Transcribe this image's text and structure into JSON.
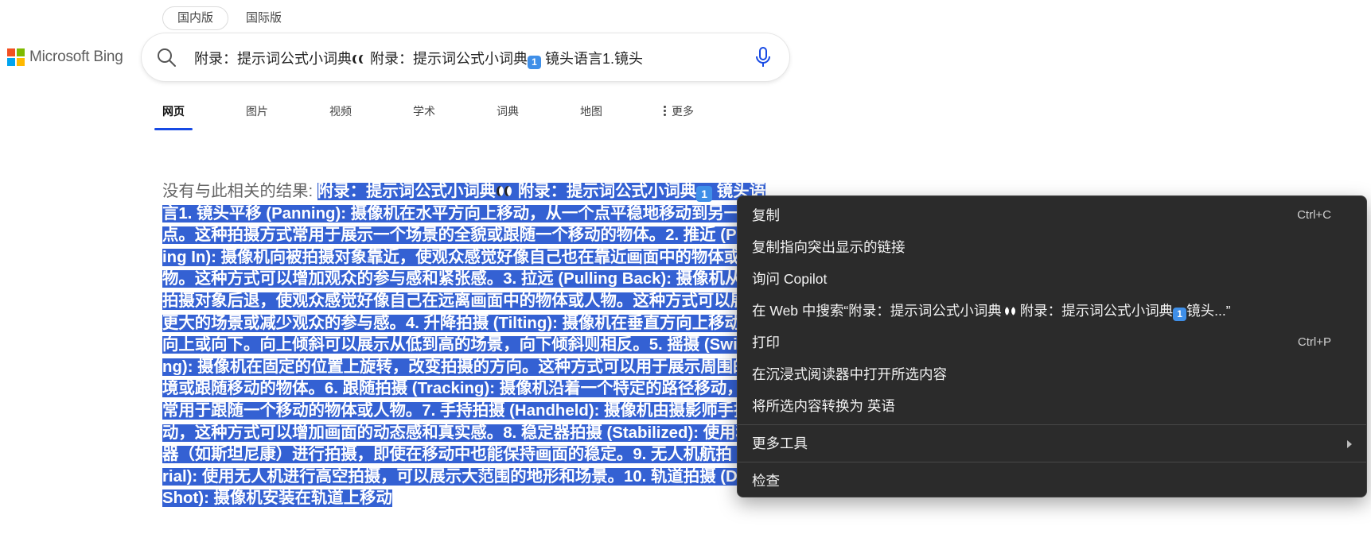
{
  "region": {
    "domestic": "国内版",
    "international": "国际版"
  },
  "logo": {
    "text": "Microsoft Bing"
  },
  "search": {
    "query_part1": "附录：提示词公式小词典",
    "query_part2": " 附录：提示词公式小词典",
    "query_keycap": "1",
    "query_part3": "镜头语言1.镜头"
  },
  "tabs": [
    "网页",
    "图片",
    "视频",
    "学术",
    "词典",
    "地图",
    "更多"
  ],
  "result": {
    "no_result_label": "没有与此相关的结果: ",
    "selected_part1": "附录：提示词公式小词典",
    "selected_part2": " 附录：提示词公式小词典",
    "selected_keycap": "1",
    "selected_part3": " 镜头语言1. 镜头平移 (Panning): 摄像机在水平方向上移动，从一个点平稳地移动到另一个点。这种拍摄方式常用于展示一个场景的全貌或跟随一个移动的物体。2. 推近 (Pushing In): 摄像机向被拍摄对象靠近，使观众感觉好像自己也在靠近画面中的物体或人物。这种方式可以增加观众的参与感和紧张感。3. 拉远 (Pulling Back): 摄像机从被拍摄对象后退，使观众感觉好像自己在远离画面中的物体或人物。这种方式可以展示更大的场景或减少观众的参与感。4. 升降拍摄 (Tilting): 摄像机在垂直方向上移动，向上或向下。向上倾斜可以展示从低到高的场景，向下倾斜则相反。5. 摇摄 (Swiveling): 摄像机在固定的位置上旋转，改变拍摄的方向。这种方式可以用于展示周围的环境或跟随移动的物体。6. 跟随拍摄 (Tracking): 摄像机沿着一个特定的路径移动，通常用于跟随一个移动的物体或人物。7. 手持拍摄 (Handheld): 摄像机由摄影师手持移动，这种方式可以增加画面的动态感和真实感。8. 稳定器拍摄 (Stabilized): 使用稳定器（如斯坦尼康）进行拍摄，即使在移动中也能保持画面的稳定。9. 无人机航拍 (Aerial): 使用无人机进行高空拍摄，可以展示大范围的地形和场景。10. 轨道拍摄 (Dolly Shot): 摄像机安装在轨道上移动"
  },
  "context_menu": {
    "copy": "复制",
    "copy_shortcut": "Ctrl+C",
    "copy_link": "复制指向突出显示的链接",
    "ask_copilot": "询问 Copilot",
    "web_search_prefix": "在 Web 中搜索“附录：提示词公式小词典",
    "web_search_mid": " 附录：提示词公式小词典",
    "web_search_keycap": "1",
    "web_search_suffix": "镜头...”",
    "print": "打印",
    "print_shortcut": "Ctrl+P",
    "immersive_reader": "在沉浸式阅读器中打开所选内容",
    "translate": "将所选内容转换为 英语",
    "more_tools": "更多工具",
    "inspect": "检查"
  },
  "colors": {
    "selection": "#3461d3",
    "tab_underline": "#174ae4",
    "menu_bg": "#2b2b2b"
  }
}
